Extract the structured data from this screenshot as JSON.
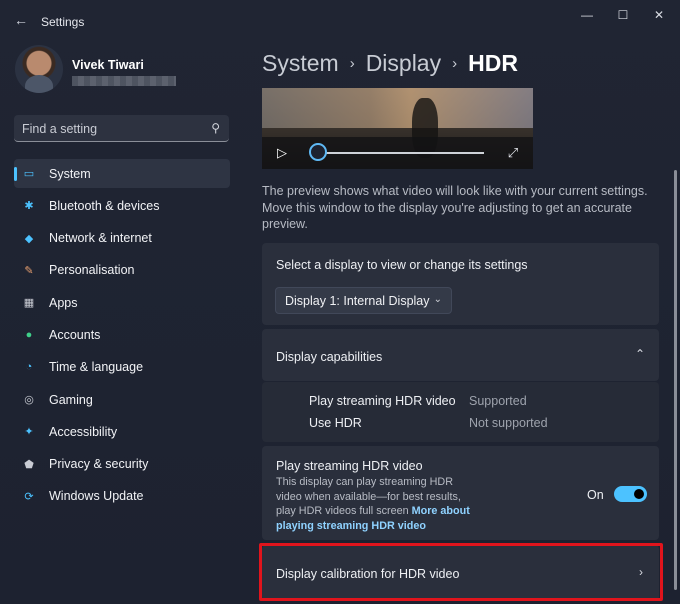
{
  "window": {
    "title": "Settings",
    "back_icon": "←",
    "controls": {
      "minimize": "—",
      "maximize": "☐",
      "close": "✕"
    }
  },
  "profile": {
    "name": "Vivek Tiwari"
  },
  "search": {
    "placeholder": "Find a setting",
    "icon": "⚲"
  },
  "sidebar": {
    "items": [
      {
        "label": "System",
        "icon": "▭",
        "color": "#4cc2ff",
        "active": true
      },
      {
        "label": "Bluetooth & devices",
        "icon": "✱",
        "color": "#4cc2ff"
      },
      {
        "label": "Network & internet",
        "icon": "◆",
        "color": "#4cc2ff"
      },
      {
        "label": "Personalisation",
        "icon": "✎",
        "color": "#e8a070"
      },
      {
        "label": "Apps",
        "icon": "▦",
        "color": "#c9ccd4"
      },
      {
        "label": "Accounts",
        "icon": "●",
        "color": "#3fd08a"
      },
      {
        "label": "Time & language",
        "icon": "◔",
        "color": "#4cc2ff"
      },
      {
        "label": "Gaming",
        "icon": "◎",
        "color": "#c9ccd4"
      },
      {
        "label": "Accessibility",
        "icon": "✦",
        "color": "#4cc2ff"
      },
      {
        "label": "Privacy & security",
        "icon": "⬟",
        "color": "#c9ccd4"
      },
      {
        "label": "Windows Update",
        "icon": "⟳",
        "color": "#4cc2ff"
      }
    ]
  },
  "breadcrumb": {
    "part1": "System",
    "sep": "›",
    "part2": "Display",
    "current": "HDR"
  },
  "video": {
    "play_icon": "▷",
    "fullscreen_icon": "⤢"
  },
  "preview_description": "The preview shows what video will look like with your current settings. Move this window to the display you're adjusting to get an accurate preview.",
  "display_select": {
    "title": "Select a display to view or change its settings",
    "value": "Display 1: Internal Display",
    "chevron": "⌄"
  },
  "capabilities": {
    "title": "Display capabilities",
    "chevron": "⌃",
    "rows": [
      {
        "name": "Play streaming HDR video",
        "value": "Supported"
      },
      {
        "name": "Use HDR",
        "value": "Not supported"
      }
    ]
  },
  "streaming": {
    "title": "Play streaming HDR video",
    "description": "This display can play streaming HDR video when available—for best results, play HDR videos full screen ",
    "link": "More about playing streaming HDR video",
    "toggle_label": "On"
  },
  "calibration": {
    "title": "Display calibration for HDR video",
    "chevron": "›"
  }
}
